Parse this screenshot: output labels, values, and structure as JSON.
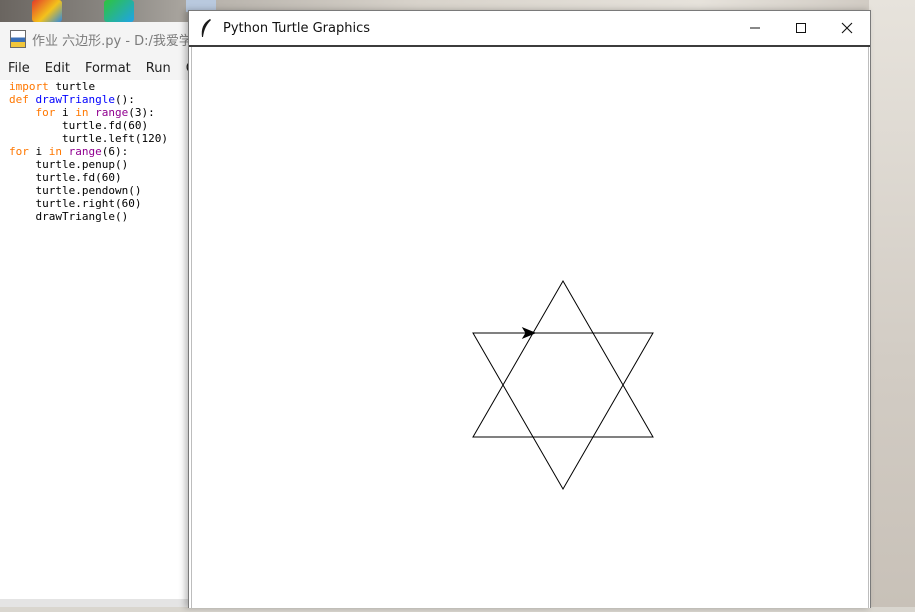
{
  "desktop": {
    "icons": [
      "app-icon-colorful",
      "app-icon-player"
    ]
  },
  "idle": {
    "title": "作业 六边形.py - D:/我爱学习",
    "menu": [
      "File",
      "Edit",
      "Format",
      "Run",
      "Op"
    ],
    "code_lines": [
      "import turtle",
      "def drawTriangle():",
      "    for i in range(3):",
      "        turtle.fd(60)",
      "        turtle.left(120)",
      "for i in range(6):",
      "    turtle.penup()",
      "    turtle.fd(60)",
      "    turtle.pendown()",
      "    turtle.right(60)",
      "    drawTriangle()"
    ]
  },
  "turtle_window": {
    "title": "Python Turtle Graphics",
    "minimize_label": "—",
    "maximize_label": "☐",
    "close_label": "✕",
    "drawing": {
      "shape": "hexagram",
      "stroke_color": "#000000",
      "turtle_heading_degrees": 0
    }
  }
}
